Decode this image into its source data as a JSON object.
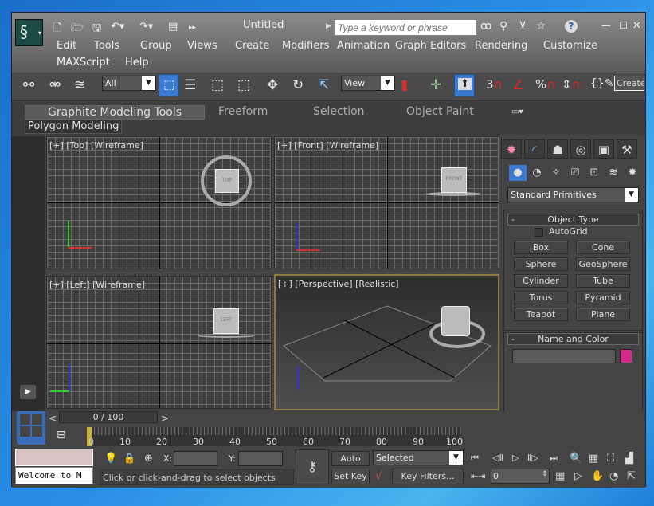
{
  "window": {
    "title": "Untitled"
  },
  "quick_access": {
    "icons": [
      "new-file-icon",
      "open-folder-icon",
      "save-icon",
      "undo-icon",
      "redo-icon",
      "project-folder-icon",
      "more-icon"
    ]
  },
  "search": {
    "placeholder": "Type a keyword or phrase"
  },
  "title_icons": [
    "binoculars-icon",
    "key-icon",
    "satellite-icon",
    "star-icon",
    "help-icon"
  ],
  "menu": {
    "items": [
      "Edit",
      "Tools",
      "Group",
      "Views",
      "Create",
      "Modifiers",
      "Animation",
      "Graph Editors",
      "Rendering",
      "Customize",
      "MAXScript",
      "Help"
    ]
  },
  "toolbar": {
    "selection_filter": "All",
    "ref_coord": "View",
    "create_label": "Create",
    "snap_value": "3"
  },
  "ribbon": {
    "tabs": [
      "Graphite Modeling Tools",
      "Freeform",
      "Selection",
      "Object Paint"
    ],
    "active_tab": "Graphite Modeling Tools",
    "panel": "Polygon Modeling"
  },
  "viewports": [
    {
      "label": "[+] [Top] [Wireframe]",
      "cube": "TOP"
    },
    {
      "label": "[+] [Front] [Wireframe]",
      "cube": "FRONT"
    },
    {
      "label": "[+] [Left] [Wireframe]",
      "cube": "LEFT"
    },
    {
      "label": "[+] [Perspective] [Realistic]",
      "cube": ""
    }
  ],
  "command_panel": {
    "category": "Standard Primitives",
    "object_type": {
      "title": "Object Type",
      "autogrid": "AutoGrid",
      "autogrid_checked": false,
      "buttons": [
        "Box",
        "Cone",
        "Sphere",
        "GeoSphere",
        "Cylinder",
        "Tube",
        "Torus",
        "Pyramid",
        "Teapot",
        "Plane"
      ]
    },
    "name_color": {
      "title": "Name and Color",
      "name_value": "",
      "color": "#d02a8a"
    }
  },
  "timeline": {
    "slider": "0 / 100",
    "prev": "<",
    "next": ">",
    "ticks": [
      "0",
      "10",
      "20",
      "30",
      "40",
      "50",
      "60",
      "70",
      "80",
      "90",
      "100"
    ]
  },
  "status": {
    "maxscript_text": "Welcome to M",
    "prompt": "Click or click-and-drag to select objects",
    "x_label": "X:",
    "y_label": "Y:",
    "x_value": "",
    "y_value": ""
  },
  "anim": {
    "auto_key": "Auto Key",
    "set_key": "Set Key",
    "key_mode": "Selected",
    "key_filters": "Key Filters...",
    "frame": "0"
  }
}
